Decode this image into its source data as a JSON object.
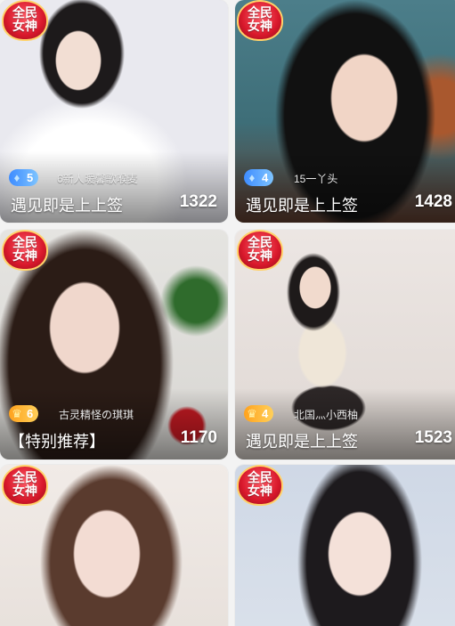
{
  "badge_text_line1": "全民",
  "badge_text_line2": "女神",
  "cards": [
    {
      "level": "5",
      "level_type": "diamond",
      "nickname": "6新人暖馨歌喉麦",
      "title": "遇见即是上上签",
      "count": "1322"
    },
    {
      "level": "4",
      "level_type": "diamond",
      "nickname": "15一丫头",
      "title": "遇见即是上上签",
      "count": "1428"
    },
    {
      "level": "6",
      "level_type": "crown",
      "nickname": "古灵精怪の琪琪",
      "title": "【特别推荐】",
      "count": "1170"
    },
    {
      "level": "4",
      "level_type": "crown",
      "nickname": "北国灬小西柚",
      "title": "遇见即是上上签",
      "count": "1523"
    },
    {
      "level": "",
      "level_type": "",
      "nickname": "",
      "title": "",
      "count": ""
    },
    {
      "level": "",
      "level_type": "",
      "nickname": "",
      "title": "",
      "count": ""
    }
  ],
  "colors": {
    "diamond_badge": "#3e8cff",
    "crown_badge": "#ffa21d",
    "goddess_badge": "#d8182b"
  },
  "icons": {
    "diamond": "diamond-icon",
    "crown": "crown-icon"
  }
}
